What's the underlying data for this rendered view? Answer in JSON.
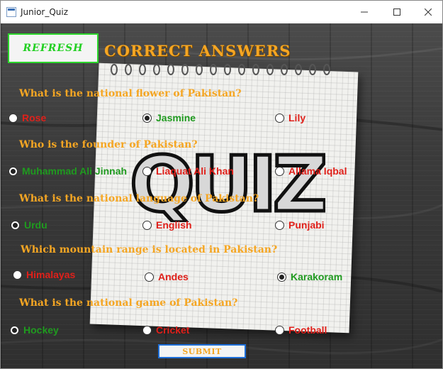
{
  "window": {
    "title": "Junior_Quiz"
  },
  "toolbar": {
    "refresh_label": "REFRESH",
    "heading": "CORRECT ANSWERS",
    "submit_label": "SUBMIT"
  },
  "background_art": {
    "text": "QUIZ"
  },
  "colors": {
    "question_text": "#f5a623",
    "correct_option": "#1f9a1f",
    "wrong_option": "#e0201a",
    "refresh_border": "#2bd62b",
    "submit_border": "#1e6fd9"
  },
  "questions": [
    {
      "text": "What is the national flower of Pakistan?",
      "options": [
        {
          "label": "Rose",
          "selected": false,
          "color": "red"
        },
        {
          "label": "Jasmine",
          "selected": true,
          "color": "green"
        },
        {
          "label": "Lily",
          "selected": false,
          "color": "red"
        }
      ]
    },
    {
      "text": "Who is the founder of Pakistan?",
      "options": [
        {
          "label": "Muhammad Ali Jinnah",
          "selected": true,
          "color": "green"
        },
        {
          "label": "Liaquat Ali Khan",
          "selected": false,
          "color": "red"
        },
        {
          "label": "Allama Iqbal",
          "selected": false,
          "color": "red"
        }
      ]
    },
    {
      "text": "What is the national language of Pakistan?",
      "options": [
        {
          "label": "Urdu",
          "selected": true,
          "color": "green"
        },
        {
          "label": "English",
          "selected": false,
          "color": "red"
        },
        {
          "label": "Punjabi",
          "selected": false,
          "color": "red"
        }
      ]
    },
    {
      "text": "Which mountain range is located in Pakistan?",
      "options": [
        {
          "label": "Himalayas",
          "selected": false,
          "color": "red"
        },
        {
          "label": "Andes",
          "selected": false,
          "color": "red"
        },
        {
          "label": "Karakoram",
          "selected": true,
          "color": "green"
        }
      ]
    },
    {
      "text": "What is the national game of Pakistan?",
      "options": [
        {
          "label": "Hockey",
          "selected": true,
          "color": "green"
        },
        {
          "label": "Cricket",
          "selected": false,
          "color": "red"
        },
        {
          "label": "Football",
          "selected": false,
          "color": "red"
        }
      ]
    }
  ]
}
